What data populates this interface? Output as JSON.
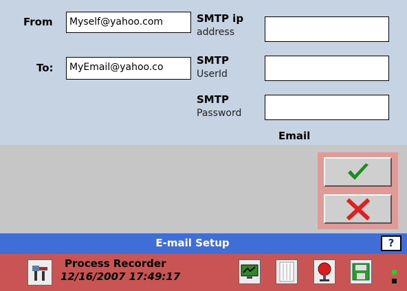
{
  "form": {
    "from_label": "From",
    "from_value": "Myself@yahoo.com",
    "to_label": "To:",
    "to_value": "MyEmail@yahoo.co",
    "smtp_ip": {
      "bold": "SMTP ip",
      "normal": "address"
    },
    "smtp_user": {
      "bold": "SMTP",
      "normal": "UserId"
    },
    "smtp_pass": {
      "bold": "SMTP",
      "normal": "Password"
    },
    "email_caption": "Email"
  },
  "titlebar": {
    "title": "E-mail Setup",
    "help_label": "?"
  },
  "status": {
    "app_name": "Process Recorder",
    "datetime": "12/16/2007 17:49:17"
  },
  "colors": {
    "panel": "#c5d3e2",
    "titlebar": "#3f6fd6",
    "statusbar": "#c85454",
    "confirm": "#1e8a1e",
    "cancel": "#e02020"
  },
  "icons": {
    "confirm": "checkmark-icon",
    "cancel": "x-icon",
    "tools": "tools-icon"
  }
}
